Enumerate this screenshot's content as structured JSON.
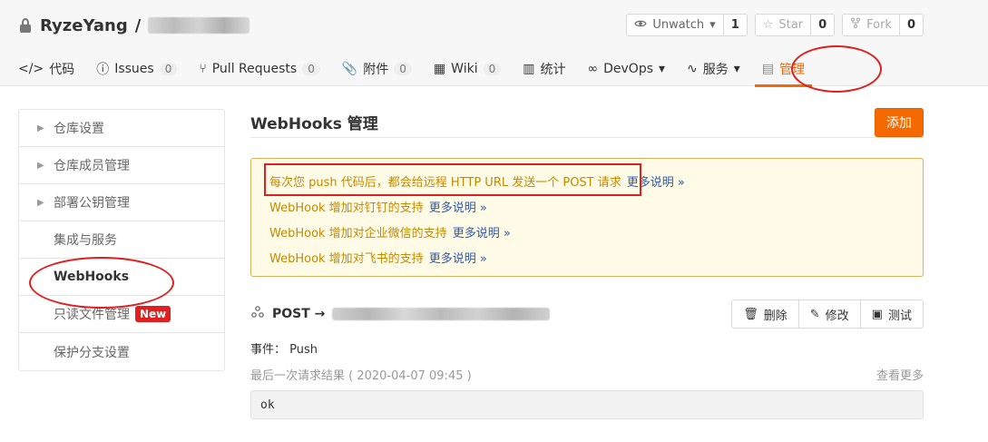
{
  "header": {
    "owner": "RyzeYang",
    "separator": "/",
    "actions": {
      "unwatch": {
        "label": "Unwatch",
        "count": "1"
      },
      "star": {
        "label": "Star",
        "count": "0"
      },
      "fork": {
        "label": "Fork",
        "count": "0"
      }
    },
    "tabs": [
      {
        "label": "代码",
        "badge": ""
      },
      {
        "label": "Issues",
        "badge": "0"
      },
      {
        "label": "Pull Requests",
        "badge": "0"
      },
      {
        "label": "附件",
        "badge": "0"
      },
      {
        "label": "Wiki",
        "badge": "0"
      },
      {
        "label": "统计",
        "badge": ""
      },
      {
        "label": "DevOps",
        "badge": ""
      },
      {
        "label": "服务",
        "badge": ""
      },
      {
        "label": "管理",
        "badge": ""
      }
    ]
  },
  "sidebar": {
    "items": [
      {
        "label": "仓库设置"
      },
      {
        "label": "仓库成员管理"
      },
      {
        "label": "部署公钥管理"
      },
      {
        "label": "集成与服务"
      },
      {
        "label": "WebHooks"
      },
      {
        "label": "只读文件管理",
        "badge": "New"
      },
      {
        "label": "保护分支设置"
      }
    ]
  },
  "main": {
    "title": "WebHooks 管理",
    "add_label": "添加",
    "notice": [
      {
        "text": "每次您 push 代码后，都会给远程 HTTP URL 发送一个 POST 请求",
        "more": "更多说明 »"
      },
      {
        "text": "WebHook 增加对钉钉的支持",
        "more": "更多说明 »"
      },
      {
        "text": "WebHook 增加对企业微信的支持",
        "more": "更多说明 »"
      },
      {
        "text": "WebHook 增加对飞书的支持",
        "more": "更多说明 »"
      }
    ],
    "hook": {
      "method": "POST →",
      "delete_label": "删除",
      "edit_label": "修改",
      "test_label": "测试"
    },
    "event_line": "事件： Push",
    "last_result": "最后一次请求结果 ( 2020-04-07 09:45 )",
    "view_more": "查看更多",
    "response": "ok"
  },
  "colors": {
    "accent": "#f56a00",
    "notice_bg": "#fffbe6",
    "notice_border": "#d7b35a",
    "annotation": "#e02020",
    "link": "#2f5aa8"
  }
}
